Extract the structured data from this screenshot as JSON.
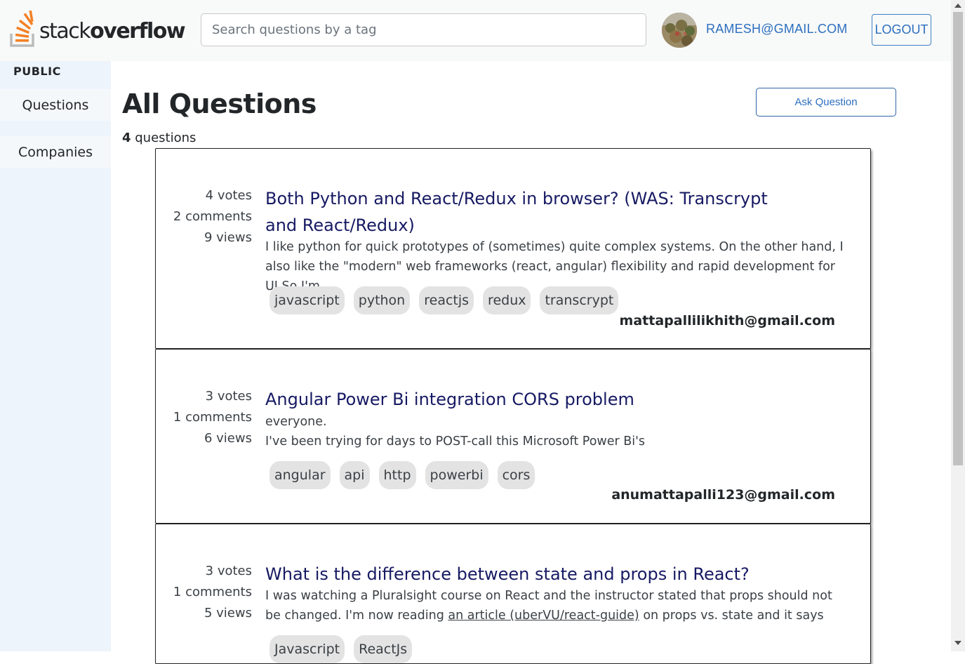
{
  "header": {
    "logo_light": "stack",
    "logo_bold": "overflow",
    "search_placeholder": "Search questions by a tag",
    "user_email": "RAMESH@GMAIL.COM",
    "logout_label": "LOGOUT"
  },
  "sidebar": {
    "heading": "PUBLIC",
    "items": [
      {
        "label": "Questions"
      },
      {
        "label": "Companies"
      }
    ]
  },
  "main": {
    "title": "All Questions",
    "count_number": "4",
    "count_label": " questions",
    "ask_label": "Ask Question"
  },
  "questions": [
    {
      "votes": "4 votes",
      "comments": "2 comments",
      "views": "9 views",
      "title": "Both Python and React/Redux in browser? (WAS: Transcrypt and React/Redux)",
      "body": "I like python for quick prototypes of (sometimes) quite complex systems. On the other hand, I also like the \"modern\" web frameworks (react, angular) flexibility and rapid development for UI.So I'm",
      "tags": [
        "javascript",
        "python",
        "reactjs",
        "redux",
        "transcrypt"
      ],
      "author": "mattapallilikhith@gmail.com"
    },
    {
      "votes": "3 votes",
      "comments": "1 comments",
      "views": "6 views",
      "title": "Angular Power Bi integration CORS problem",
      "body_line1": "everyone.",
      "body_line2": "I've been trying for days to POST-call this Microsoft Power Bi's",
      "tags": [
        "angular",
        "api",
        "http",
        "powerbi",
        "cors"
      ],
      "author": "anumattapalli123@gmail.com"
    },
    {
      "votes": "3 votes",
      "comments": "1 comments",
      "views": "5 views",
      "title": "What is the difference between state and props in React?",
      "body_pre": "I was watching a Pluralsight course on React and the instructor stated that props should not be changed. I'm now reading ",
      "body_link": "an article (uberVU/react-guide)",
      "body_post": " on props vs. state and it says",
      "tags": [
        "Javascript",
        "ReactJs"
      ]
    }
  ],
  "colors": {
    "title_link": "#171a63",
    "accent_blue": "#2d6fbf",
    "sidebar_bg": "#eef4fb",
    "logo_orange": "#f48024"
  }
}
